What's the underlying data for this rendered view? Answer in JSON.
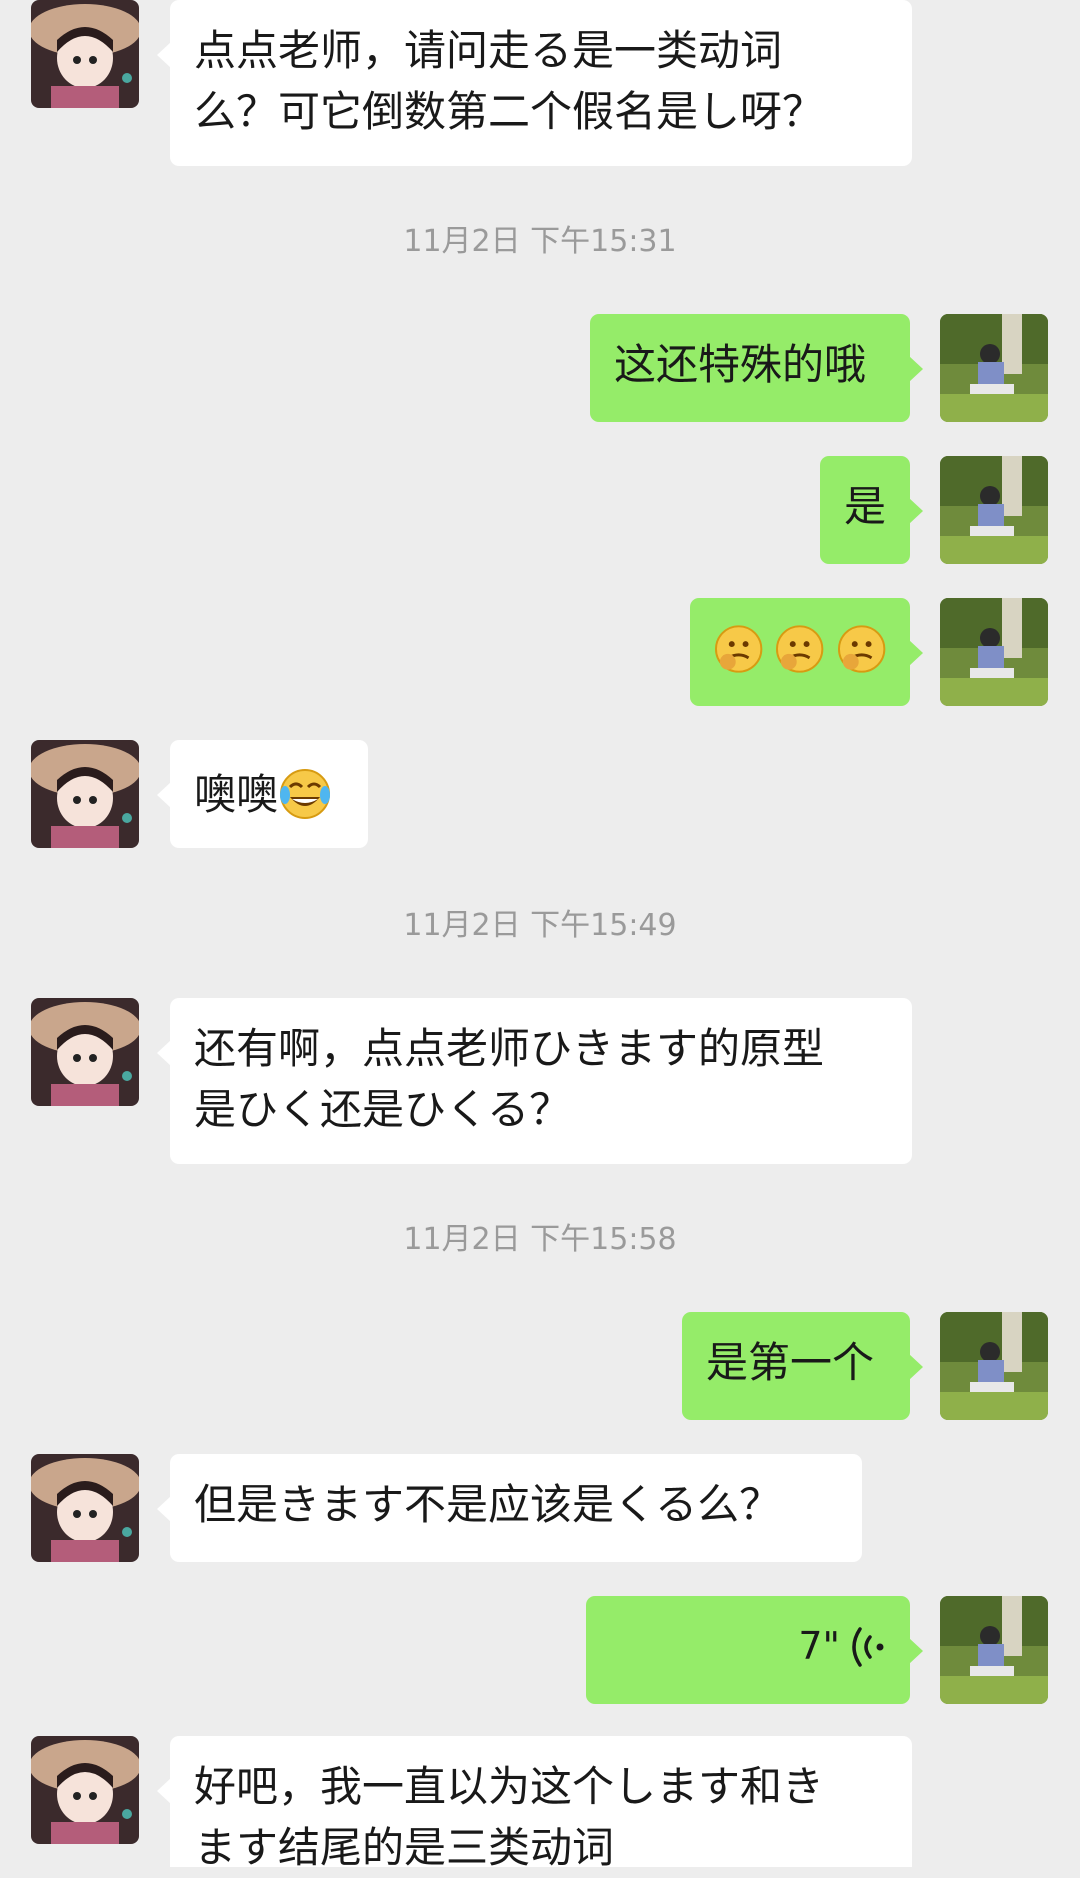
{
  "messages": {
    "m1": {
      "sender": "other",
      "text_line1": "点点老师，请问走る是一类动词",
      "text_line2": "么？可它倒数第二个假名是し呀？"
    },
    "ts1": "11月2日 下午15:31",
    "m2": {
      "sender": "me",
      "text": "这还特殊的哦"
    },
    "m3": {
      "sender": "me",
      "text": "是"
    },
    "m4": {
      "sender": "me",
      "emoji": [
        "thinking-face",
        "thinking-face",
        "thinking-face"
      ]
    },
    "m5": {
      "sender": "other",
      "text": "噢噢",
      "emoji": "tears-of-joy-face"
    },
    "ts2": "11月2日 下午15:49",
    "m6": {
      "sender": "other",
      "text_line1": "还有啊，点点老师ひきます的原型",
      "text_line2": "是ひく还是ひくる？"
    },
    "ts3": "11月2日 下午15:58",
    "m7": {
      "sender": "me",
      "text": "是第一个"
    },
    "m8": {
      "sender": "other",
      "text": "但是きます不是应该是くる么？"
    },
    "m9": {
      "sender": "me",
      "voice_duration": "7\"",
      "icon": "voice-wave-icon"
    },
    "m10": {
      "sender": "other",
      "text_line1": "好吧，我一直以为这个します和き",
      "text_line2": "ます结尾的是三类动词"
    }
  },
  "colors": {
    "background": "#ededed",
    "incoming_bubble": "#ffffff",
    "outgoing_bubble": "#95ec69",
    "timestamp": "#9a9a9a"
  }
}
